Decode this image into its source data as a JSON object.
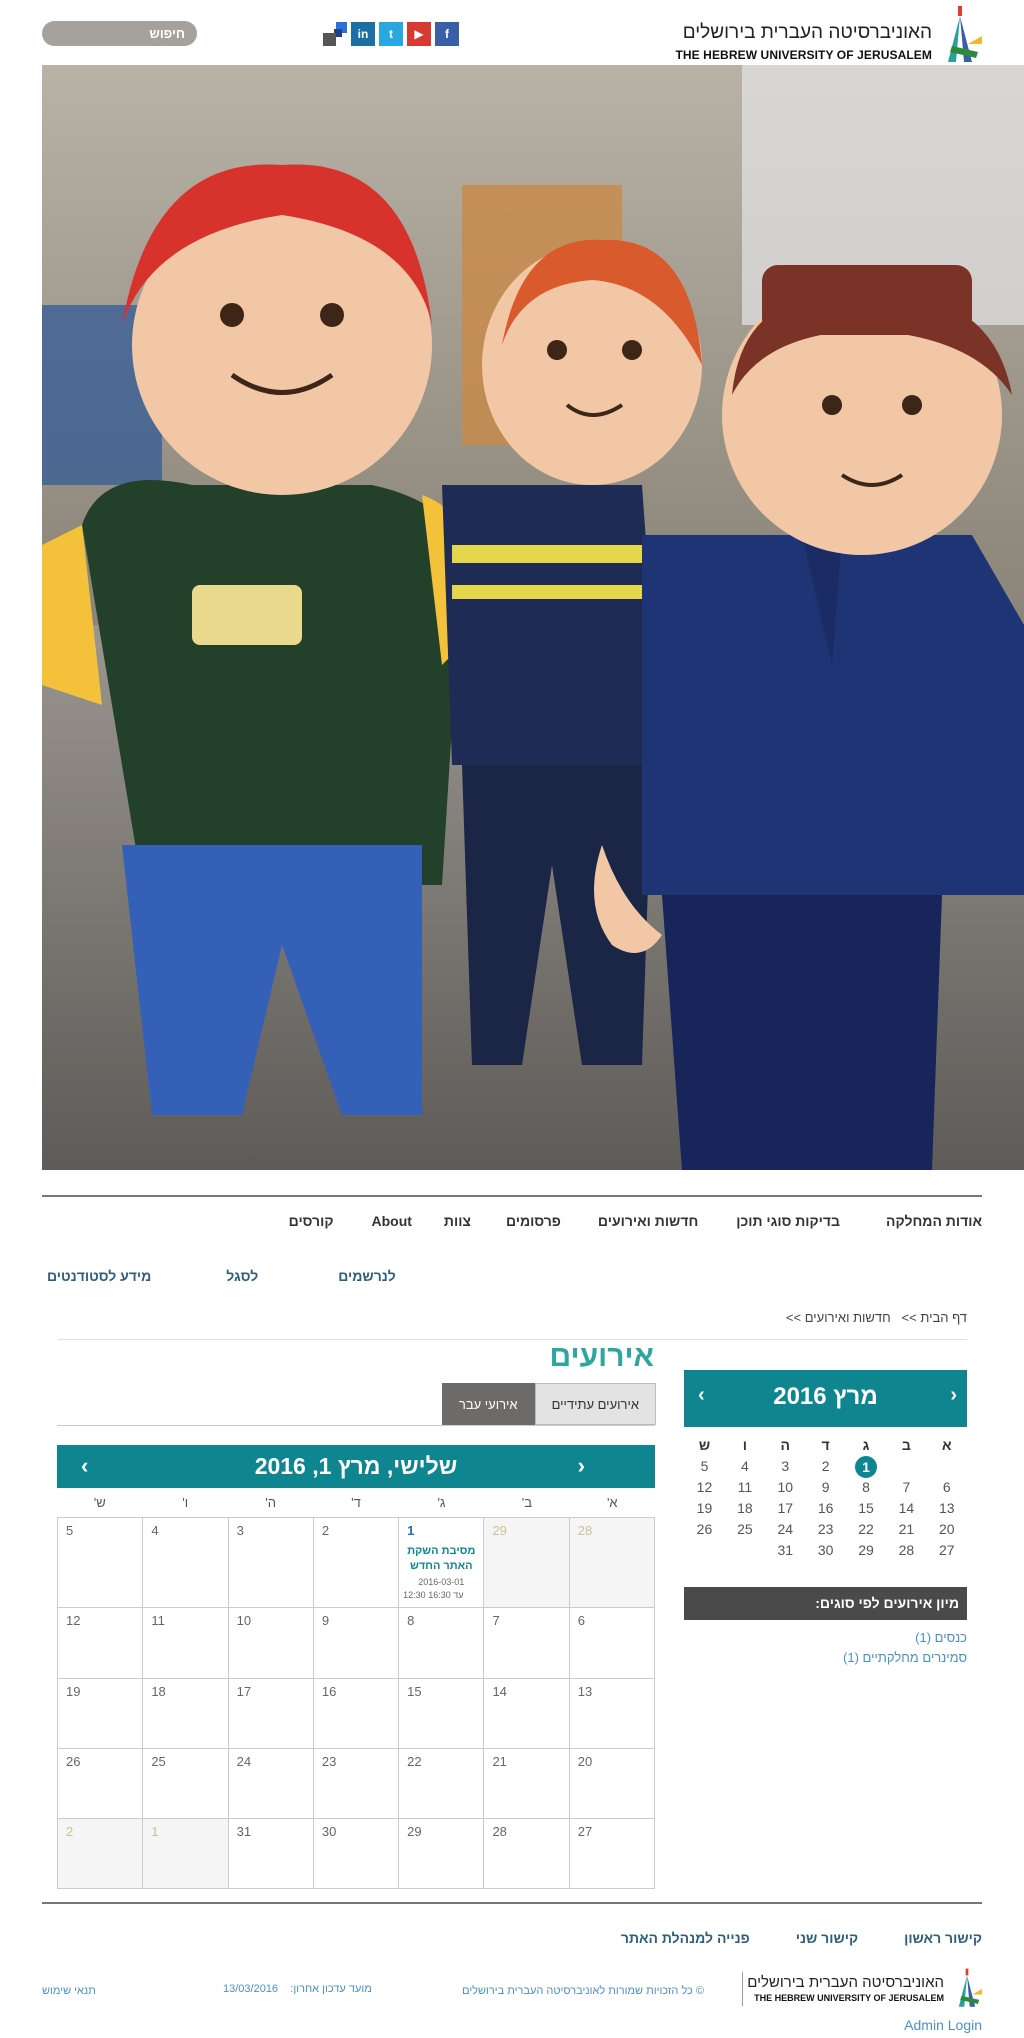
{
  "header": {
    "logo_he": "האוניברסיטה העברית בירושלים",
    "logo_en": "THE HEBREW UNIVERSITY OF JERUSALEM",
    "search_label": "חיפוש",
    "social": [
      "f",
      "▶",
      "t",
      "in"
    ]
  },
  "nav": {
    "row1": [
      "אודות המחלקה",
      "בדיקות סוגי תוכן",
      "חדשות ואירועים",
      "פרסומים",
      "צוות",
      "About",
      "קורסים"
    ],
    "row2": [
      "לנרשמים",
      "לסגל",
      "מידע לסטודנטים"
    ]
  },
  "breadcrumb": {
    "home": "דף הבית",
    "sep": ">>",
    "current": "חדשות ואירועים",
    "sep2": ">>"
  },
  "events": {
    "title": "אירועים",
    "tab_future": "אירועים עתידיים",
    "tab_past": "אירועי עבר"
  },
  "calendar": {
    "title": "שלישי, מרץ 1, 2016",
    "prev": "‹",
    "next": "›",
    "dow": [
      "א'",
      "ב'",
      "ג'",
      "ד'",
      "ה'",
      "ו'",
      "ש'"
    ],
    "weeks": [
      [
        "28",
        "29",
        "1",
        "2",
        "3",
        "4",
        "5"
      ],
      [
        "6",
        "7",
        "8",
        "9",
        "10",
        "11",
        "12"
      ],
      [
        "13",
        "14",
        "15",
        "16",
        "17",
        "18",
        "19"
      ],
      [
        "20",
        "21",
        "22",
        "23",
        "24",
        "25",
        "26"
      ],
      [
        "27",
        "28",
        "29",
        "30",
        "31",
        "1",
        "2"
      ]
    ],
    "event": {
      "title": "מסיבת השקת האתר החדש",
      "date": "2016-03-01",
      "time": "12:30 עד 16:30"
    }
  },
  "mini_calendar": {
    "title": "מרץ 2016",
    "prev": "‹",
    "next": "›",
    "dow": [
      "א",
      "ב",
      "ג",
      "ד",
      "ה",
      "ו",
      "ש"
    ],
    "weeks": [
      [
        "",
        "",
        "1",
        "2",
        "3",
        "4",
        "5"
      ],
      [
        "6",
        "7",
        "8",
        "9",
        "10",
        "11",
        "12"
      ],
      [
        "13",
        "14",
        "15",
        "16",
        "17",
        "18",
        "19"
      ],
      [
        "20",
        "21",
        "22",
        "23",
        "24",
        "25",
        "26"
      ],
      [
        "27",
        "28",
        "29",
        "30",
        "31",
        "",
        ""
      ]
    ]
  },
  "sort": {
    "title": "מיון אירועים לפי סוגים:",
    "items": [
      "כנסים (1)",
      "סמינרים מחלקתיים (1)"
    ]
  },
  "footer": {
    "links": [
      "קישור ראשון",
      "קישור שני",
      "פנייה למנהלת האתר"
    ],
    "logo_he": "האוניברסיטה העברית בירושלים",
    "logo_en": "THE HEBREW UNIVERSITY OF JERUSALEM",
    "copyright": "© כל הזכויות שמורות לאוניברסיטה העברית בירושלים",
    "updated_label": "מועד עדכון אחרון:",
    "updated_date": "13/03/2016",
    "terms": "תנאי שימוש",
    "admin": "Admin Login"
  },
  "colors": {
    "teal": "#0f868f",
    "nav_blue": "#2e5f7b",
    "link_blue": "#4a90c9",
    "dark_gray": "#4a4a4a"
  }
}
